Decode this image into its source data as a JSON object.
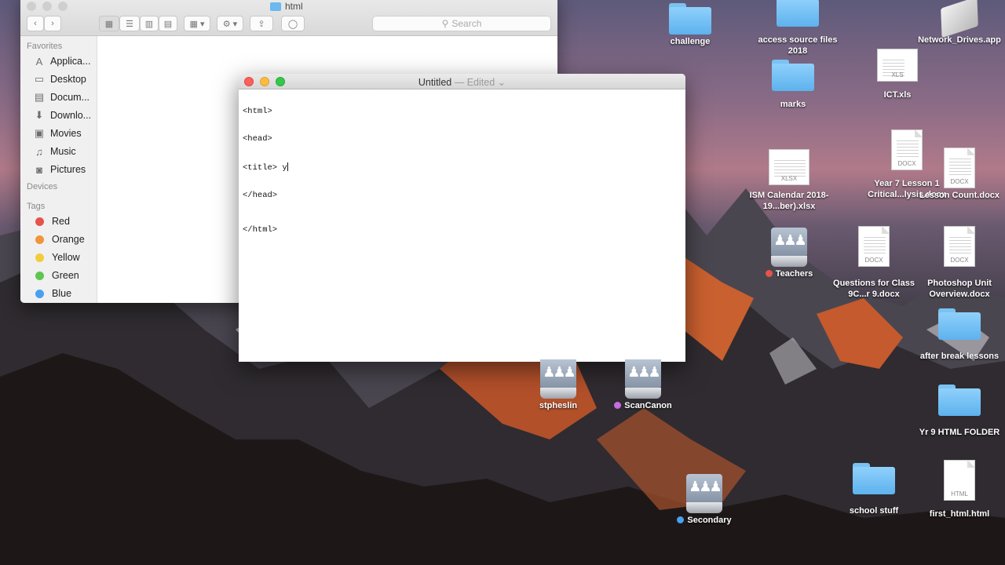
{
  "finder": {
    "title": "html",
    "search_placeholder": "Search",
    "sections": {
      "favorites": "Favorites",
      "devices": "Devices",
      "tags": "Tags"
    },
    "favorites": [
      {
        "label": "Applica...",
        "icon": "applications-icon"
      },
      {
        "label": "Desktop",
        "icon": "desktop-icon"
      },
      {
        "label": "Docum...",
        "icon": "documents-icon"
      },
      {
        "label": "Downlo...",
        "icon": "downloads-icon"
      },
      {
        "label": "Movies",
        "icon": "movies-icon"
      },
      {
        "label": "Music",
        "icon": "music-icon"
      },
      {
        "label": "Pictures",
        "icon": "pictures-icon"
      }
    ],
    "tags": [
      {
        "label": "Red",
        "color": "#e5534b"
      },
      {
        "label": "Orange",
        "color": "#f0953a"
      },
      {
        "label": "Yellow",
        "color": "#f2cd3a"
      },
      {
        "label": "Green",
        "color": "#5ec64f"
      },
      {
        "label": "Blue",
        "color": "#4aa0f0"
      }
    ]
  },
  "textedit": {
    "title": "Untitled",
    "separator": "—",
    "status": "Edited",
    "lines": [
      "<html>",
      "<head>",
      "<title> y",
      "</head>"
    ],
    "closing_line": "</html>"
  },
  "desktop": {
    "icons": {
      "challenge": "challenge",
      "access": "access source files 2018",
      "network": "Network_Drives.app",
      "marks": "marks",
      "ict": "ICT.xls",
      "ict_ext": "XLS",
      "year7": "Year 7 Lesson 1 Critical...lysis.docx",
      "year7_ext": "DOCX",
      "ism": "ISM Calendar 2018-19...ber).xlsx",
      "ism_ext": "XLSX",
      "lessoncount": "Lesson Count.docx",
      "lessoncount_ext": "DOCX",
      "teachers": "Teachers",
      "questions": "Questions for Class 9C...r 9.docx",
      "questions_ext": "DOCX",
      "photoshop": "Photoshop Unit Overview.docx",
      "photoshop_ext": "DOCX",
      "afterbreak": "after break lessons",
      "stpheslin": "stpheslin",
      "scancanon": "ScanCanon",
      "yr9": "Yr 9 HTML FOLDER",
      "schoolstuff": "school stuff",
      "firsthtml": "first_html.html",
      "firsthtml_ext": "HTML",
      "secondary": "Secondary"
    },
    "label_colors": {
      "teachers": "#e5534b",
      "scancanon": "#c46de0",
      "secondary": "#4aa0f0"
    }
  }
}
